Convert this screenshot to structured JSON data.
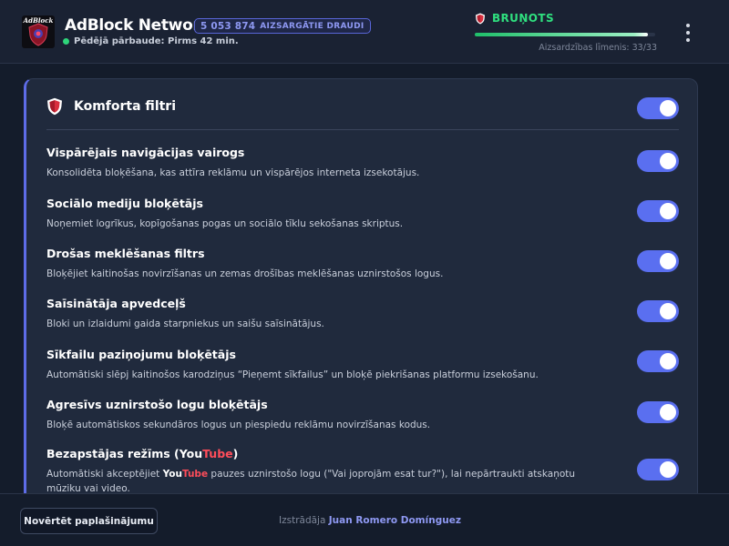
{
  "header": {
    "logo_text": "AdBlock",
    "app_title": "AdBlock Network",
    "badge_count": "5 053 874",
    "badge_label": "AIZSARGĀTIE DRAUDI",
    "last_check": "Pēdējā pārbaude: Pirms 42 min.",
    "status": "BRUŅOTS",
    "protection_level_text": "Aizsardzības līmenis: 33/33",
    "protection_progress": 0.96
  },
  "card": {
    "title": "Komforta filtri",
    "master_toggle_on": true,
    "filters": [
      {
        "title": "Vispārējais navigācijas vairogs",
        "description": "Konsolidēta bloķēšana, kas attīra reklāmu un vispārējos interneta izsekotājus.",
        "enabled": true
      },
      {
        "title": "Sociālo mediju bloķētājs",
        "description": "Noņemiet logrīkus, kopīgošanas pogas un sociālo tīklu sekošanas skriptus.",
        "enabled": true
      },
      {
        "title": "Drošas meklēšanas filtrs",
        "description": "Bloķējiet kaitinošas novirzīšanas un zemas drošības meklēšanas uznirstošos logus.",
        "enabled": true
      },
      {
        "title": "Saīsinātāja apvedceļš",
        "description": "Bloki un izlaidumi gaida starpniekus un saišu saīsinātājus.",
        "enabled": true
      },
      {
        "title": "Sīkfailu paziņojumu bloķētājs",
        "description": "Automātiski slēpj kaitinošos karodziņus “Pieņemt sīkfailus” un bloķē piekrišanas platformu izsekošanu.",
        "enabled": true
      },
      {
        "title": "Agresīvs uznirstošo logu bloķētājs",
        "description": "Bloķē automātiskos sekundāros logus un piespiedu reklāmu novirzīšanas kodus.",
        "enabled": true
      },
      {
        "title_prefix": "Bezapstājas režīms (",
        "title_you": "You",
        "title_tube": "Tube",
        "title_suffix": ")",
        "desc_prefix": "Automātiski akceptējiet ",
        "desc_you": "You",
        "desc_tube": "Tube",
        "desc_suffix": " pauzes uznirstošo logu (\"Vai joprojām esat tur?\"), lai nepārtraukti atskaņotu mūziku vai video.",
        "enabled": true
      }
    ]
  },
  "footer": {
    "rate_button": "Novērtēt paplašinājumu",
    "credit_prefix": "Izstrādāja",
    "author": "Juan Romero Domínguez"
  },
  "colors": {
    "accent": "#5a6ff0",
    "status_green": "#2fe07f",
    "youtube_red": "#ff4d5a",
    "shield_red": "#d92f3f"
  }
}
